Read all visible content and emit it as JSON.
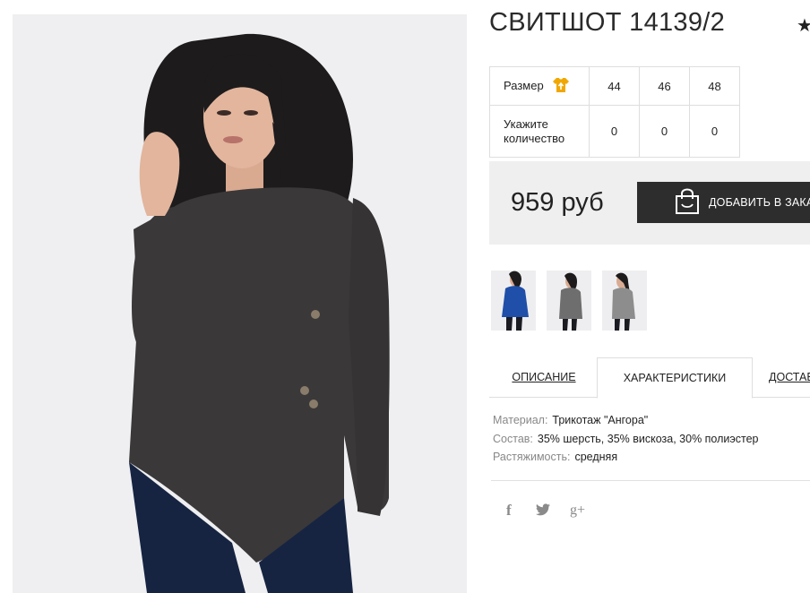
{
  "product": {
    "title": "СВИТШОТ 14139/2",
    "price": "959 руб",
    "add_to_cart_label": "ДОБАВИТЬ В ЗАКАЗ"
  },
  "size_table": {
    "size_label": "Размер",
    "qty_label": "Укажите количество",
    "sizes": [
      "44",
      "46",
      "48"
    ],
    "quantities": [
      "0",
      "0",
      "0"
    ]
  },
  "thumbnails": [
    {
      "color": "#1f4fa8",
      "icon": "product-thumbnail-blue"
    },
    {
      "color": "#6e6e6e",
      "icon": "product-thumbnail-grey"
    },
    {
      "color": "#8d8d8d",
      "icon": "product-thumbnail-light-grey"
    }
  ],
  "tabs": {
    "description": "ОПИСАНИЕ",
    "characteristics": "ХАРАКТЕРИСТИКИ",
    "delivery": "ДОСТАВКА"
  },
  "specs": [
    {
      "key": "Материал:",
      "value": "Трикотаж \"Ангора\""
    },
    {
      "key": "Состав:",
      "value": "35% шерсть, 35% вискоза, 30% полиэстер"
    },
    {
      "key": "Растяжимость:",
      "value": "средняя"
    }
  ],
  "social": {
    "facebook": "f",
    "twitter": "twitter-icon",
    "googleplus": "g+"
  },
  "colors": {
    "accent_icon": "#f0a800",
    "button_bg": "#2d2d2d",
    "price_bg": "#efefef"
  }
}
